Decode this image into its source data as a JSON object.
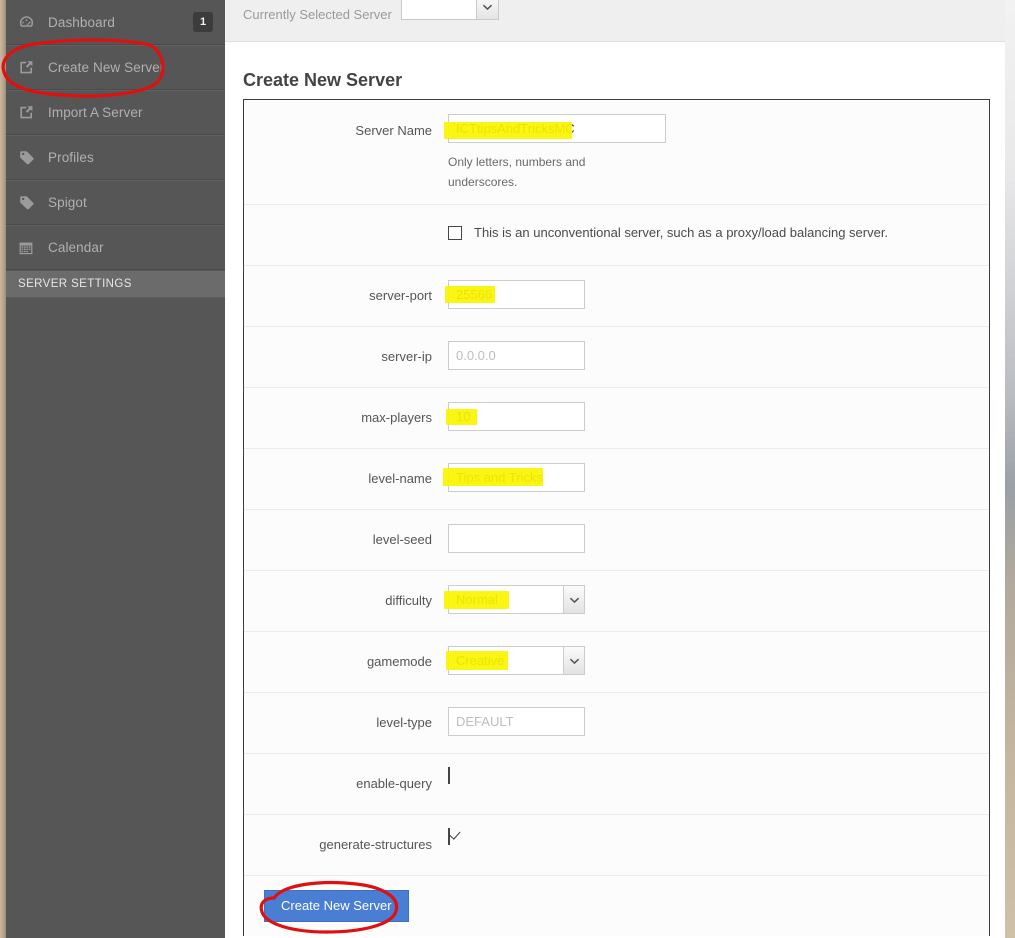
{
  "sidebar": {
    "items": [
      {
        "label": "Dashboard",
        "icon": "dashboard-icon",
        "badge": "1"
      },
      {
        "label": "Create New Server",
        "icon": "external-link-icon",
        "badge": ""
      },
      {
        "label": "Import A Server",
        "icon": "external-link-icon",
        "badge": ""
      },
      {
        "label": "Profiles",
        "icon": "tag-icon",
        "badge": ""
      },
      {
        "label": "Spigot",
        "icon": "tag-icon",
        "badge": ""
      },
      {
        "label": "Calendar",
        "icon": "calendar-icon",
        "badge": ""
      }
    ],
    "section_header": "SERVER SETTINGS"
  },
  "topbar": {
    "breadcrumb_label": "Currently Selected Server",
    "breadcrumb_separator": "›",
    "server_select_value": "",
    "server_select_icon": "chevron-down-icon"
  },
  "page": {
    "title": "Create New Server"
  },
  "form": {
    "server_name": {
      "label": "Server Name",
      "value": "ICTtipsAndTricksMC",
      "hint": "Only letters, numbers and underscores."
    },
    "unconventional": {
      "label": "This is an unconventional server, such as a proxy/load balancing server.",
      "checked": false
    },
    "server_port": {
      "label": "server-port",
      "value": "25566",
      "placeholder": ""
    },
    "server_ip": {
      "label": "server-ip",
      "value": "",
      "placeholder": "0.0.0.0"
    },
    "max_players": {
      "label": "max-players",
      "value": "10",
      "placeholder": ""
    },
    "level_name": {
      "label": "level-name",
      "value": "Tips and Tricks",
      "placeholder": ""
    },
    "level_seed": {
      "label": "level-seed",
      "value": "",
      "placeholder": ""
    },
    "difficulty": {
      "label": "difficulty",
      "value": "Normal",
      "icon": "chevron-down-icon"
    },
    "gamemode": {
      "label": "gamemode",
      "value": "Creative",
      "icon": "chevron-down-icon"
    },
    "level_type": {
      "label": "level-type",
      "value": "",
      "placeholder": "DEFAULT"
    },
    "enable_query": {
      "label": "enable-query",
      "checked": false
    },
    "generate_structures": {
      "label": "generate-structures",
      "checked": true
    },
    "submit_label": "Create New Server"
  },
  "colors": {
    "sidebar_bg": "#565656",
    "sidebar_section_bg": "#6b6b6b",
    "accent_button": "#4a7ed4",
    "highlight_marker": "#fbf400",
    "annotation_red": "#e01010"
  }
}
